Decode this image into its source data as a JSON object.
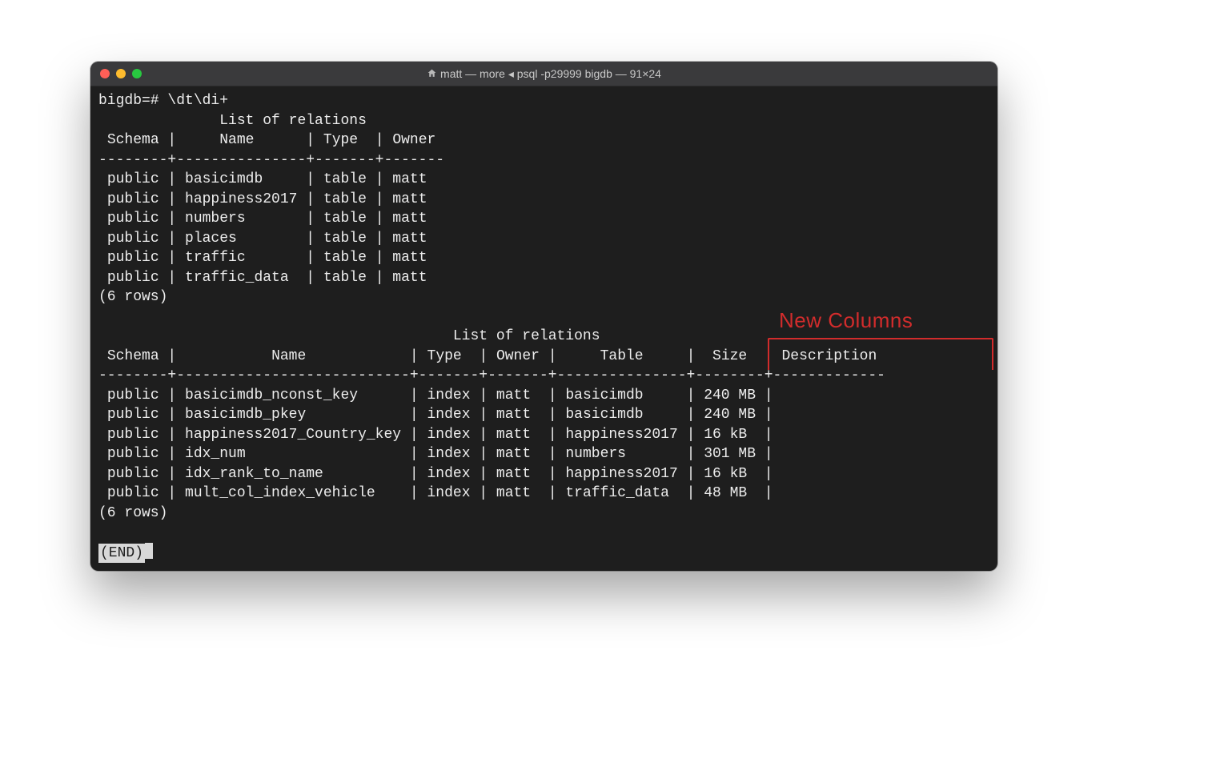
{
  "window": {
    "title": "matt — more ◂ psql -p29999 bigdb — 91×24",
    "home_icon": "home-icon"
  },
  "traffic_lights": {
    "red": "close",
    "yellow": "minimize",
    "green": "zoom"
  },
  "prompt": "bigdb=# \\dt\\di+",
  "table1": {
    "title": "List of relations",
    "headers": [
      "Schema",
      "Name",
      "Type",
      "Owner"
    ],
    "rows": [
      {
        "schema": "public",
        "name": "basicimdb",
        "type": "table",
        "owner": "matt"
      },
      {
        "schema": "public",
        "name": "happiness2017",
        "type": "table",
        "owner": "matt"
      },
      {
        "schema": "public",
        "name": "numbers",
        "type": "table",
        "owner": "matt"
      },
      {
        "schema": "public",
        "name": "places",
        "type": "table",
        "owner": "matt"
      },
      {
        "schema": "public",
        "name": "traffic",
        "type": "table",
        "owner": "matt"
      },
      {
        "schema": "public",
        "name": "traffic_data",
        "type": "table",
        "owner": "matt"
      }
    ],
    "footer": "(6 rows)"
  },
  "table2": {
    "title": "List of relations",
    "headers": [
      "Schema",
      "Name",
      "Type",
      "Owner",
      "Table",
      "Size",
      "Description"
    ],
    "rows": [
      {
        "schema": "public",
        "name": "basicimdb_nconst_key",
        "type": "index",
        "owner": "matt",
        "table": "basicimdb",
        "size": "240 MB",
        "description": ""
      },
      {
        "schema": "public",
        "name": "basicimdb_pkey",
        "type": "index",
        "owner": "matt",
        "table": "basicimdb",
        "size": "240 MB",
        "description": ""
      },
      {
        "schema": "public",
        "name": "happiness2017_Country_key",
        "type": "index",
        "owner": "matt",
        "table": "happiness2017",
        "size": "16 kB",
        "description": ""
      },
      {
        "schema": "public",
        "name": "idx_num",
        "type": "index",
        "owner": "matt",
        "table": "numbers",
        "size": "301 MB",
        "description": ""
      },
      {
        "schema": "public",
        "name": "idx_rank_to_name",
        "type": "index",
        "owner": "matt",
        "table": "happiness2017",
        "size": "16 kB",
        "description": ""
      },
      {
        "schema": "public",
        "name": "mult_col_index_vehicle",
        "type": "index",
        "owner": "matt",
        "table": "traffic_data",
        "size": "48 MB",
        "description": ""
      }
    ],
    "footer": "(6 rows)"
  },
  "end_marker": "(END)",
  "annotation": {
    "label": "New Columns"
  },
  "colors": {
    "terminal_bg": "#1e1e1e",
    "titlebar_bg": "#3a3a3c",
    "text": "#ededed",
    "annotation": "#d22c2c"
  }
}
